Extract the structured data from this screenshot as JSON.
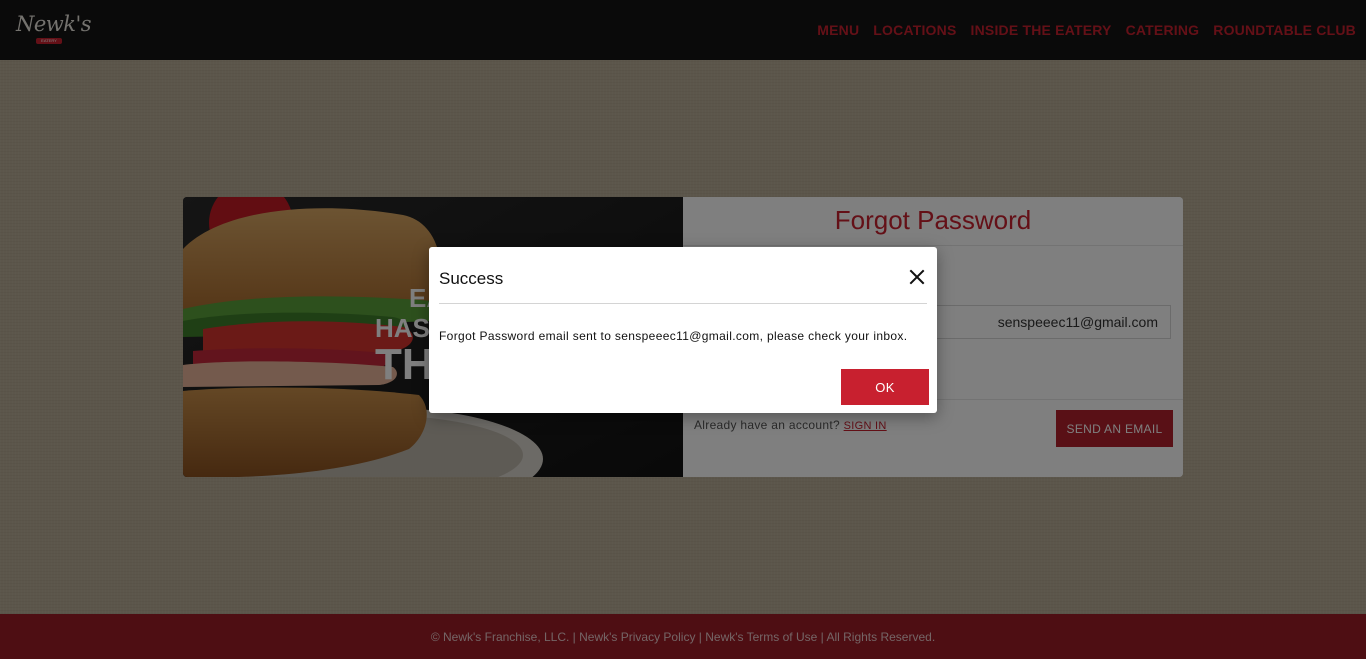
{
  "brand": {
    "logo_text": "Newk's",
    "logo_tag": "EATERY",
    "accent_color": "#c8202f"
  },
  "nav": {
    "items": [
      {
        "label": "MENU"
      },
      {
        "label": "LOCATIONS"
      },
      {
        "label": "INSIDE THE EATERY"
      },
      {
        "label": "CATERING"
      },
      {
        "label": "ROUNDTABLE CLUB"
      }
    ]
  },
  "promo": {
    "line1": "EA",
    "line2": "HAS",
    "line3": "TH"
  },
  "form": {
    "title": "Forgot Password",
    "email_value": "senspeeec11@gmail.com",
    "account_prompt": "Already have an account?",
    "sign_in_label": "SIGN IN",
    "send_label": "SEND AN EMAIL"
  },
  "modal": {
    "title": "Success",
    "close_icon": "close-icon",
    "message": "Forgot Password email sent to senspeeec11@gmail.com, please check your inbox.",
    "ok_label": "OK"
  },
  "footer": {
    "text": "© Newk's Franchise, LLC. | Newk's Privacy Policy | Newk's Terms of Use | All Rights Reserved."
  }
}
